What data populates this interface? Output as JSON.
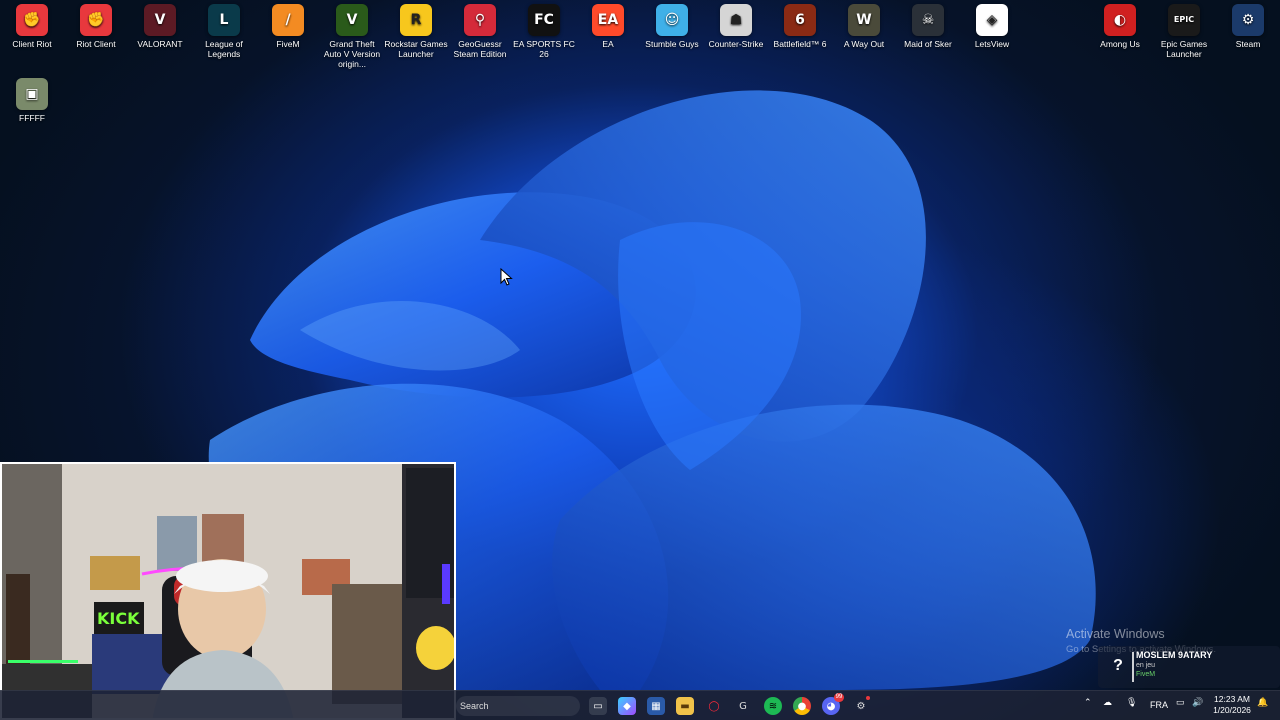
{
  "desktop": {
    "icons": [
      {
        "label": "Client Riot",
        "icon": "riot-fist-icon",
        "color": "#e8383d",
        "glyph": "✊"
      },
      {
        "label": "Riot Client",
        "icon": "riot-fist-icon",
        "color": "#e8383d",
        "glyph": "✊"
      },
      {
        "label": "VALORANT",
        "icon": "valorant-icon",
        "color": "#5c1a24",
        "glyph": "V"
      },
      {
        "label": "League of Legends",
        "icon": "league-icon",
        "color": "#0a3a4a",
        "glyph": "L"
      },
      {
        "label": "FiveM",
        "icon": "fivem-icon",
        "color": "#f38b22",
        "glyph": "/"
      },
      {
        "label": "Grand Theft Auto V Version origin...",
        "icon": "gta-v-icon",
        "color": "#2a5a1a",
        "glyph": "V"
      },
      {
        "label": "Rockstar Games Launcher",
        "icon": "rockstar-icon",
        "color": "#f7c71d",
        "glyph": "R"
      },
      {
        "label": "GeoGuessr Steam Edition",
        "icon": "geoguessr-icon",
        "color": "#d42a3a",
        "glyph": "⚲"
      },
      {
        "label": "EA SPORTS FC 26",
        "icon": "fc26-icon",
        "color": "#111111",
        "glyph": "FC"
      },
      {
        "label": "EA",
        "icon": "ea-icon",
        "color": "#ff4a2a",
        "glyph": "EA"
      },
      {
        "label": "Stumble Guys",
        "icon": "stumble-guys-icon",
        "color": "#3fb0e8",
        "glyph": "☺"
      },
      {
        "label": "Counter-Strike",
        "icon": "counter-strike-icon",
        "color": "#d5d5d5",
        "glyph": "☗"
      },
      {
        "label": "Battlefield™ 6",
        "icon": "battlefield-icon",
        "color": "#8a2a14",
        "glyph": "6"
      },
      {
        "label": "A Way Out",
        "icon": "a-way-out-icon",
        "color": "#4a4a3a",
        "glyph": "W"
      },
      {
        "label": "Maid of Sker",
        "icon": "maid-of-sker-icon",
        "color": "#2a3038",
        "glyph": "☠"
      },
      {
        "label": "LetsView",
        "icon": "letsview-icon",
        "color": "#ffffff",
        "glyph": "◈"
      },
      {
        "label": "Among Us",
        "icon": "among-us-icon",
        "color": "#d02020",
        "glyph": "◐"
      },
      {
        "label": "Epic Games Launcher",
        "icon": "epic-games-icon",
        "color": "#1a1a1a",
        "glyph": "EPIC"
      },
      {
        "label": "Steam",
        "icon": "steam-icon",
        "color": "#1b3a6a",
        "glyph": "⚙"
      },
      {
        "label": "FFFFF",
        "icon": "photo-file-icon",
        "color": "#7a8a6a",
        "glyph": "▣"
      }
    ],
    "watermark": {
      "title": "Activate Windows",
      "subtitle": "Go to Settings to activate Windows."
    }
  },
  "notification": {
    "name": "MOSLEM 9ATARY",
    "status": "en jeu",
    "game": "FiveM"
  },
  "taskbar": {
    "search_label": "Search",
    "language": "FRA",
    "time": "12:23 AM",
    "date": "1/20/2026",
    "discord_badge": "99"
  }
}
